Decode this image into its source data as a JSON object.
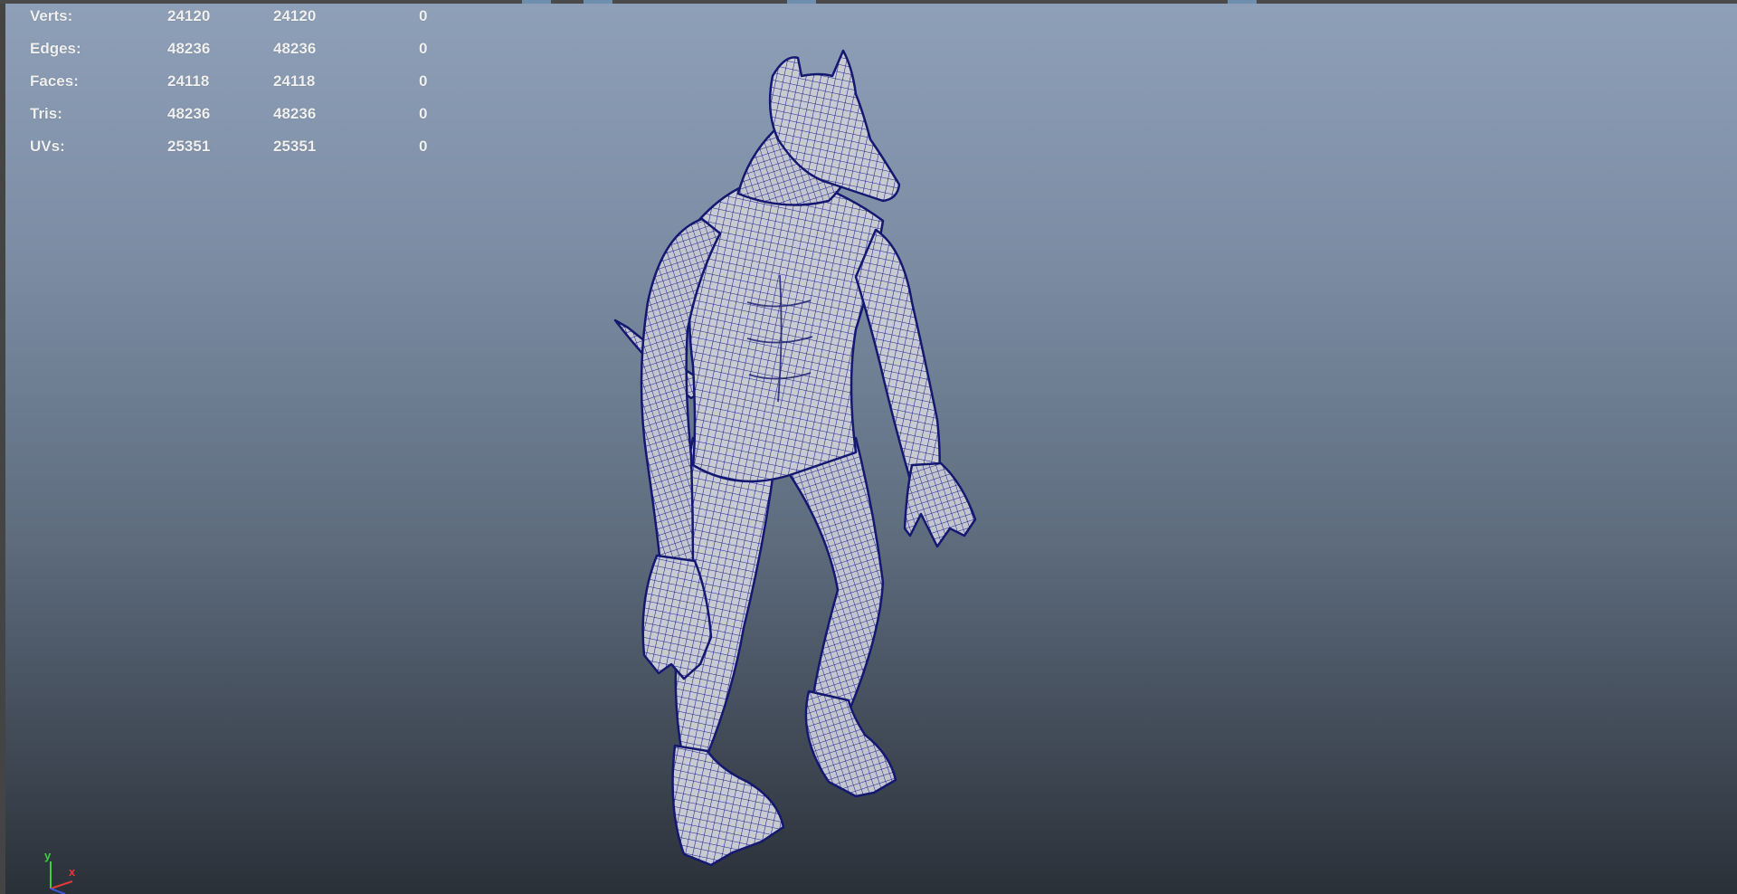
{
  "hud": {
    "rows": [
      {
        "label": "Verts:",
        "c1": "24120",
        "c2": "24120",
        "c3": "0"
      },
      {
        "label": "Edges:",
        "c1": "48236",
        "c2": "48236",
        "c3": "0"
      },
      {
        "label": "Faces:",
        "c1": "24118",
        "c2": "24118",
        "c3": "0"
      },
      {
        "label": "Tris:",
        "c1": "48236",
        "c2": "48236",
        "c3": "0"
      },
      {
        "label": "UVs:",
        "c1": "25351",
        "c2": "25351",
        "c3": "0"
      }
    ]
  },
  "axis": {
    "y_label": "y",
    "x_label": "x",
    "y_color": "#3ad23a",
    "x_color": "#e23a3a",
    "z_color": "#3a5ae2"
  },
  "colors": {
    "wireframe": "#1a1f8a",
    "mesh_fill": "#c9cbd3"
  },
  "icons": {
    "axis": "axis-gizmo-icon",
    "model": "werewolf-wireframe-mesh"
  }
}
